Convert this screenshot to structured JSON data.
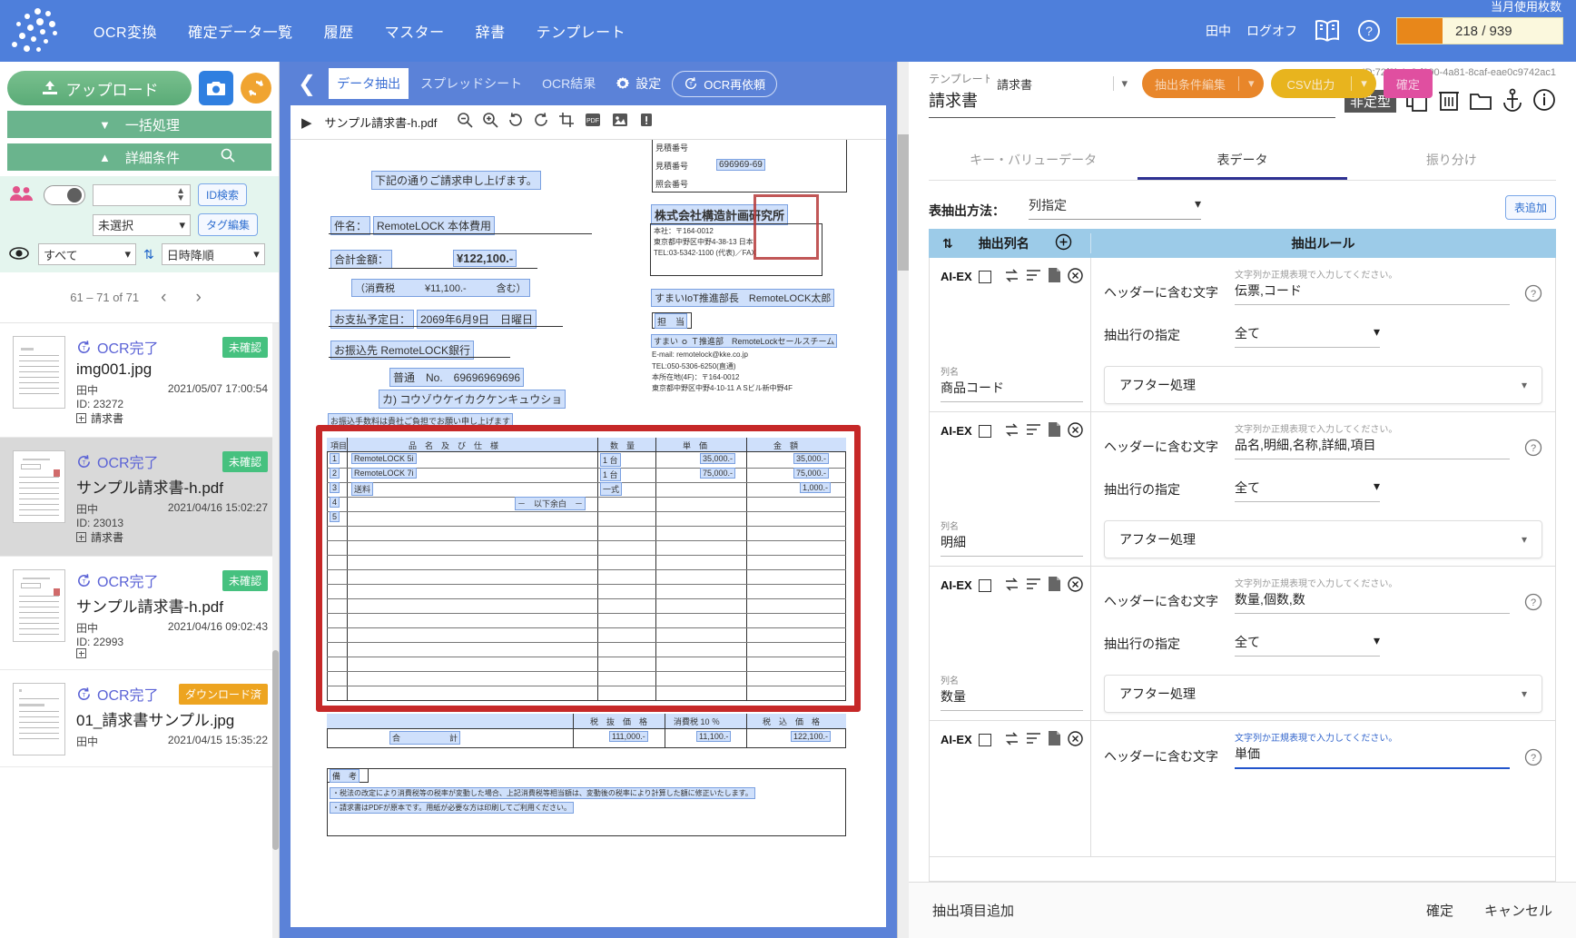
{
  "header": {
    "nav": [
      {
        "label": "OCR変換"
      },
      {
        "label": "確定データ一覧"
      },
      {
        "label": "履歴"
      },
      {
        "label": "マスター"
      },
      {
        "label": "辞書"
      },
      {
        "label": "テンプレート"
      }
    ],
    "user": "田中",
    "logoff": "ログオフ",
    "manual_icon": "book-icon",
    "help_icon": "help-icon",
    "usage_label": "当月使用枚数",
    "usage_value": "218 / 939",
    "usage_accent": "#e8871a"
  },
  "sidebar": {
    "upload_label": "アップロード",
    "camera_icon": "camera-icon",
    "refresh_icon": "refresh-icon",
    "bulk_label": "一括処理",
    "detail_label": "詳細条件",
    "search_icon": "search-icon",
    "people_icon": "people-icon",
    "id_search_label": "ID検索",
    "tag_select_value": "未選択",
    "tag_edit_label": "タグ編集",
    "eye_icon": "eye-icon",
    "view_filter_value": "すべて",
    "sort_icon": "sort-icon",
    "sort_value": "日時降順",
    "pagination": "61 – 71 of 71",
    "prev_icon": "chevron-left-icon",
    "next_icon": "chevron-right-icon",
    "documents": [
      {
        "status": "OCR完了",
        "badge": "未確認",
        "badge_type": "unconfirmed",
        "name": "img001.jpg",
        "owner": "田中",
        "datetime": "2021/05/07 17:00:54",
        "id": "ID: 23272",
        "tag": "請求書",
        "selected": false
      },
      {
        "status": "OCR完了",
        "badge": "未確認",
        "badge_type": "unconfirmed",
        "name": "サンプル請求書-h.pdf",
        "owner": "田中",
        "datetime": "2021/04/16 15:02:27",
        "id": "ID: 23013",
        "tag": "請求書",
        "selected": true
      },
      {
        "status": "OCR完了",
        "badge": "未確認",
        "badge_type": "unconfirmed",
        "name": "サンプル請求書-h.pdf",
        "owner": "田中",
        "datetime": "2021/04/16 09:02:43",
        "id": "ID: 22993",
        "tag": "",
        "selected": false
      },
      {
        "status": "OCR完了",
        "badge": "ダウンロード済",
        "badge_type": "downloaded",
        "name": "01_請求書サンプル.jpg",
        "owner": "田中",
        "datetime": "2021/04/15 15:35:22",
        "id": "",
        "tag": "",
        "selected": false
      }
    ]
  },
  "viewer_toolbar": {
    "back_icon": "chevron-left-icon",
    "tabs": [
      {
        "label": "データ抽出",
        "active": true
      },
      {
        "label": "スプレッドシート",
        "active": false
      },
      {
        "label": "OCR結果",
        "active": false
      }
    ],
    "gear_icon": "gear-icon",
    "settings_label": "設定",
    "reocr_label": "OCR再依頼",
    "template_select": "請求書",
    "edit_conditions_label": "抽出条件編集",
    "csv_label": "CSV出力",
    "confirm_label": "確定",
    "accent_orange": "#e8862a",
    "accent_yellow": "#e8b41e",
    "accent_pink": "#e04fa0"
  },
  "viewer": {
    "play_icon": "play-icon",
    "file_title": "サンプル請求書-h.pdf",
    "zoom_out_icon": "zoom-out-icon",
    "zoom_in_icon": "zoom-in-icon",
    "rotate_left_icon": "rotate-left-icon",
    "rotate_right_icon": "rotate-right-icon",
    "crop_icon": "crop-icon",
    "pdf_icon": "pdf-icon",
    "image_icon": "image-icon",
    "alert_icon": "alert-icon",
    "doc": {
      "statement": "下記の通りご請求申し上げます。",
      "subject_label": "件名：",
      "subject_value": "RemoteLOCK 本体費用",
      "total_label": "合計金額：",
      "total_value": "¥122,100.-",
      "tax_note": "（消費税　　　¥11,100.-　　　含む）",
      "pay_label": "お支払予定日：",
      "pay_value": "2069年6月9日　日曜日",
      "bank_label": "お振込先 RemoteLOCK銀行",
      "bank_line1": "普通　No.　69696969696",
      "bank_line2": "カ) コウゾウケイカクケンキュウショ",
      "bank_note": "お振込手数料は貴社ご負担でお願い申し上げます",
      "quote_no_label": "見積番号",
      "quote_no": "696969-69",
      "ref_no_label": "照会番号",
      "company": "株式会社構造計画研究所",
      "company_addr1": "本社：〒164-0012",
      "company_addr2": "東京都中野区中野4-38-13 日本",
      "company_tel": "TEL:03-5342-1100 (代表)／FAX",
      "dept": "すまいIoT推進部長　RemoteLOCK太郎",
      "charge_label": "担　当",
      "charge1": "すまい ｏ Ｔ推進部　RemoteLockセールスチーム",
      "charge2": "E-mail: remotelock@kke.co.jp",
      "charge3": "TEL:050-5306-6250(直通)",
      "charge4": "本所在地(4F)：〒164-0012",
      "charge5": "東京都中野区中野4-10-11 A Sビル新中野4F",
      "table_headers": [
        "項目",
        "品　名　及　び　仕　様",
        "数　量",
        "単　価",
        "金　額"
      ],
      "rows": [
        {
          "no": "1",
          "name": "RemoteLOCK 5i",
          "qty": "1 台",
          "price": "35,000.-",
          "amount": "35,000.-"
        },
        {
          "no": "2",
          "name": "RemoteLOCK 7i",
          "qty": "1 台",
          "price": "75,000.-",
          "amount": "75,000.-"
        },
        {
          "no": "3",
          "name": "送料",
          "qty": "一式",
          "price": "",
          "amount": "1,000.-"
        },
        {
          "no": "4",
          "name": "－　以下余白　－",
          "qty": "",
          "price": "",
          "amount": ""
        },
        {
          "no": "5",
          "name": "",
          "qty": "",
          "price": "",
          "amount": ""
        }
      ],
      "footer_headers": [
        "税　抜　価　格",
        "消費税 10 ％",
        "税　込　価　格"
      ],
      "footer_total_label": "合　　　　　　計",
      "footer_values": [
        "111,000.-",
        "11,100.-",
        "122,100.-"
      ],
      "remarks_label": "備　考",
      "remark1": "・税法の改定により消費税等の税率が変動した場合、上記消費税等相当額は、変動後の税率により計算した額に修正いたします。",
      "remark2": "・請求書はPDFが原本です。用紙が必要な方は印刷してご利用ください。"
    }
  },
  "right_panel": {
    "template_id": "ID:72f3b4e3-f090-4a81-8caf-eae0c9742ac1",
    "template_label": "テンプレート名",
    "template_name": "請求書",
    "type_chip": "非定型",
    "icons": [
      "copy-icon",
      "trash-icon",
      "folder-icon",
      "anchor-icon",
      "info-icon"
    ],
    "tabs": [
      {
        "label": "キー・バリューデータ",
        "active": false
      },
      {
        "label": "表データ",
        "active": true
      },
      {
        "label": "振り分け",
        "active": false
      }
    ],
    "method_label": "表抽出方法：",
    "method_value": "列指定",
    "add_table_label": "表追加",
    "grid_headers": {
      "sort_icon": "sort-updown-icon",
      "column_name": "抽出列名",
      "add_icon": "plus-circle-icon",
      "rule": "抽出ルール"
    },
    "row_icons": [
      "swap-icon",
      "list-icon",
      "doc-icon",
      "delete-circle-icon"
    ],
    "labels": {
      "aiex": "AI-EX",
      "column_label": "列名",
      "header_contains": "ヘッダーに含む文字",
      "row_spec": "抽出行の指定",
      "after_process": "アフター処理",
      "hint": "文字列か正規表現で入力してください。"
    },
    "rules": [
      {
        "column_name": "商品コード",
        "header_contains": "伝票,コード",
        "row_spec": "全て",
        "after_process": "アフター処理",
        "focused": false
      },
      {
        "column_name": "明細",
        "header_contains": "品名,明細,名称,詳細,項目",
        "row_spec": "全て",
        "after_process": "アフター処理",
        "focused": false
      },
      {
        "column_name": "数量",
        "header_contains": "数量,個数,数",
        "row_spec": "全て",
        "after_process": "アフター処理",
        "focused": false
      },
      {
        "column_name": "単価",
        "header_contains": "単価",
        "row_spec": "",
        "after_process": "",
        "focused": true
      }
    ],
    "footer": {
      "add_item": "抽出項目追加",
      "confirm": "確定",
      "cancel": "キャンセル"
    }
  }
}
